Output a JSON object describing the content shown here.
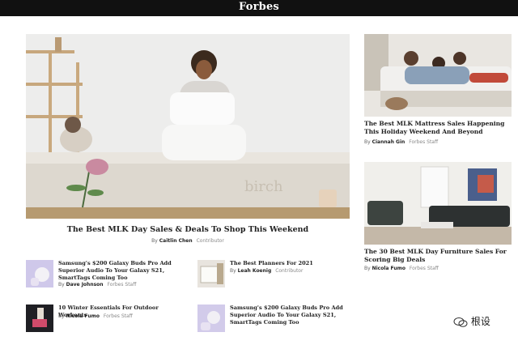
{
  "header": {
    "logo": "Forbes"
  },
  "hero": {
    "title": "The Best MLK Day Sales & Deals To Shop This Weekend",
    "by_prefix": "By",
    "author": "Caitlin Chen",
    "role": "Contributor",
    "image_text": "birch"
  },
  "side": [
    {
      "title": "The Best MLK Mattress Sales Happening This Holiday Weekend And Beyond",
      "by_prefix": "By",
      "author": "Ciannah Gin",
      "role": "Forbes Staff"
    },
    {
      "title": "The 30 Best MLK Day Furniture Sales For Scoring Big Deals",
      "by_prefix": "By",
      "author": "Nicola Fumo",
      "role": "Forbes Staff"
    }
  ],
  "stories": [
    {
      "title": "Samsung's $200 Galaxy Buds Pro Add Superior Audio To Your Galaxy S21, SmartTags Coming Too",
      "by_prefix": "By",
      "author": "Dave Johnson",
      "role": "Forbes Staff"
    },
    {
      "title": "The Best Planners For 2021",
      "by_prefix": "By",
      "author": "Leah Koenig",
      "role": "Contributor"
    },
    {
      "title": "10 Winter Essentials For Outdoor Workouts",
      "by_prefix": "By",
      "author": "Nicola Fumo",
      "role": "Forbes Staff"
    },
    {
      "title": "Samsung's $200 Galaxy Buds Pro Add Superior Audio To Your Galaxy S21, SmartTags Coming Too",
      "by_prefix": "By",
      "author": "",
      "role": ""
    }
  ],
  "watermark": {
    "text": "根设",
    "icon": "wechat-icon"
  },
  "colors": {
    "topbar": "#111111",
    "logo": "#ffffff"
  }
}
